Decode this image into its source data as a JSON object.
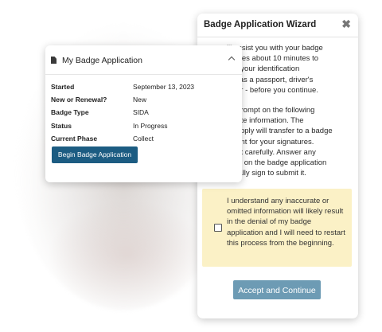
{
  "wizard": {
    "title": "Badge Application Wizard",
    "close_glyph": "✖",
    "intro_1": "will assist you with your badge\nnd takes about 10 minutes to\nather your identification\n such as a passport, driver's\nsimilar - before you continue.",
    "intro_2": "each prompt on the following\n accurate information. The\nyou supply will transfer to a badge\nocument for your signatures.\ncument carefully. Answer any\nestions on the badge application\nd digitally sign to submit it.",
    "notice": "I understand any inaccurate or omitted information will likely result in the denial of my badge application and I will need to restart this process from the beginning.",
    "accept_label": "Accept and Continue"
  },
  "card": {
    "title": "My Badge Application",
    "rows": [
      {
        "label": "Started",
        "value": "September 13, 2023"
      },
      {
        "label": "New or Renewal?",
        "value": "New"
      },
      {
        "label": "Badge Type",
        "value": "SIDA"
      },
      {
        "label": "Status",
        "value": "In Progress"
      },
      {
        "label": "Current Phase",
        "value": "Collect"
      }
    ],
    "begin_label": "Begin Badge Application"
  },
  "colors": {
    "accent_dark": "#1c5c82",
    "accent_muted": "#6d9bb4",
    "notice_bg": "#fbf1c6"
  },
  "icons": {
    "card_icon": "document-icon",
    "collapse_icon": "chevron-up-icon",
    "close_icon": "close-icon"
  }
}
